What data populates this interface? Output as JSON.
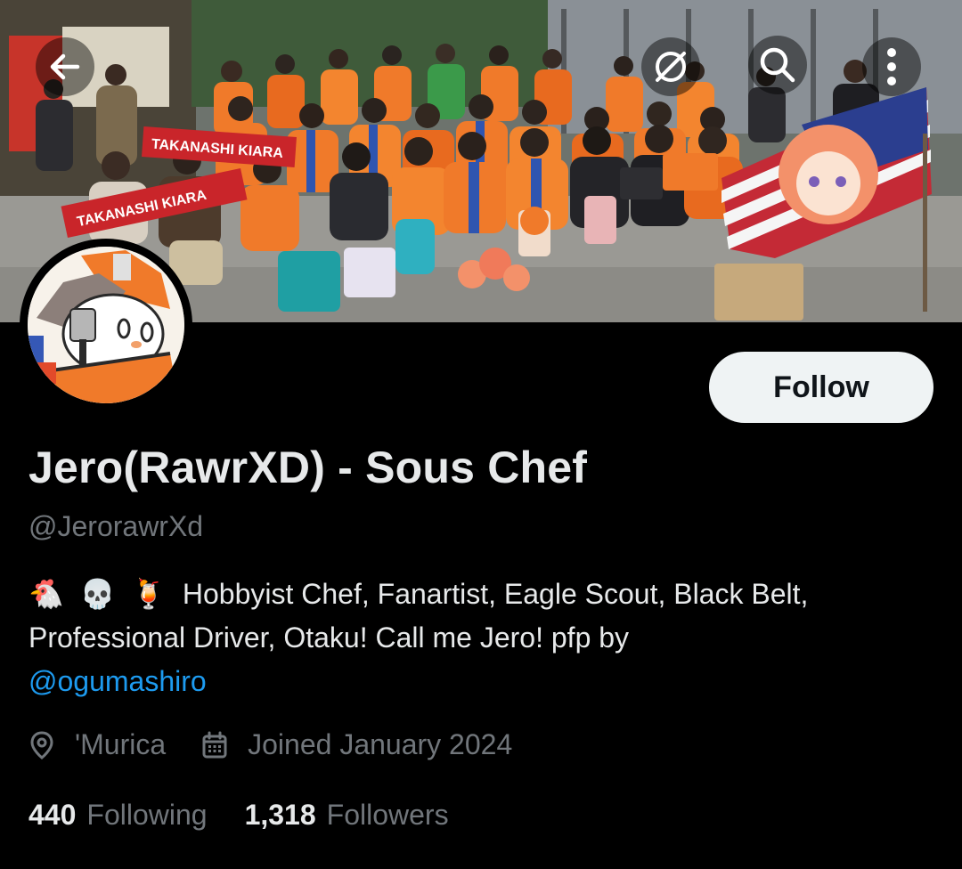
{
  "profile": {
    "display_name": "Jero(RawrXD) - Sous Chef",
    "handle": "@JerorawrXd",
    "bio": {
      "emojis": [
        "🐔",
        "💀",
        "🍹"
      ],
      "text": "Hobbyist Chef, Fanartist, Eagle Scout, Black Belt, Professional Driver, Otaku! Call me Jero! pfp by",
      "mention": "@ogumashiro"
    },
    "location": "'Murica",
    "joined": "Joined January 2024",
    "following_count": "440",
    "following_label": "Following",
    "followers_count": "1,318",
    "followers_label": "Followers"
  },
  "actions": {
    "follow_label": "Follow"
  },
  "banner": {
    "scarf_text_1": "TAKANASHI KIARA",
    "scarf_text_2": "TAKANASHI KIARA"
  },
  "icons": {
    "back": "arrow-left-icon",
    "hide": "eye-slash-icon",
    "search": "search-icon",
    "more": "more-vertical-icon",
    "location": "location-pin-icon",
    "calendar": "calendar-icon"
  },
  "colors": {
    "background": "#000000",
    "primary_text": "#e7e9ea",
    "secondary_text": "#71767b",
    "link": "#1d9bf0",
    "button_bg": "#eff3f4",
    "button_text": "#0f1419",
    "banner_orange": "#f07a2a"
  }
}
